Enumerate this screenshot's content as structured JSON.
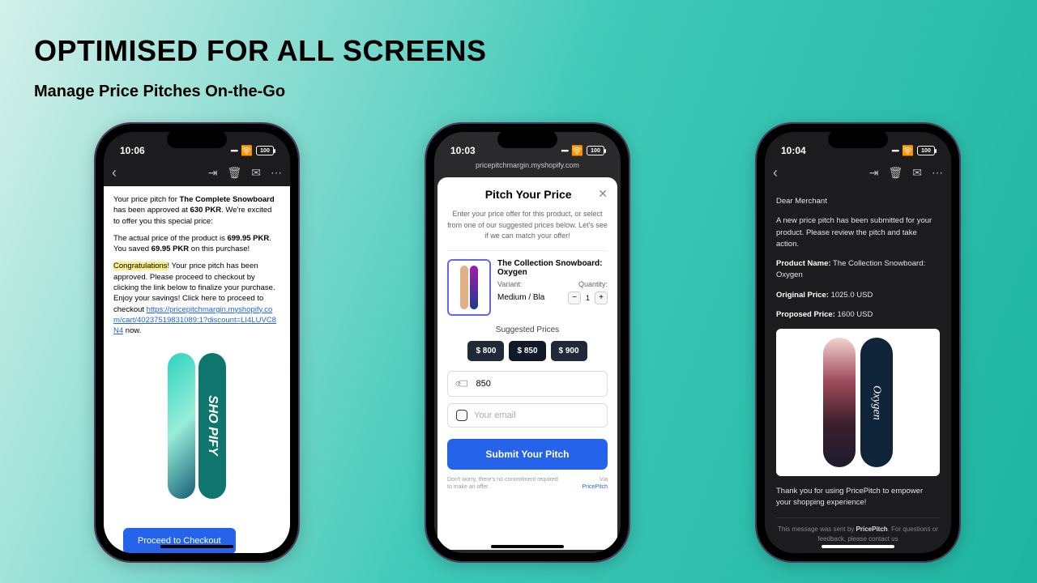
{
  "header": {
    "title": "OPTIMISED FOR ALL SCREENS",
    "subtitle": "Manage Price Pitches On-the-Go"
  },
  "phone1": {
    "time": "10:06",
    "battery": "100",
    "email": {
      "line1a": "Your price pitch for ",
      "line1b": "The Complete Snowboard",
      "line1c": " has been approved at ",
      "line1d": "630 PKR",
      "line1e": ". We're excited to offer you this special price:",
      "line2a": "The actual price of the product is ",
      "line2b": "699.95 PKR",
      "line2c": ". You saved ",
      "line2d": "69.95 PKR",
      "line2e": " on this purchase!",
      "congrats": "Congratulations",
      "line3": "! Your price pitch has been approved. Please proceed to checkout by clicking the link below to finalize your purchase. Enjoy your savings! Click here to proceed to checkout ",
      "link": "https://pricepitchmargin.myshopify.com/cart/40237519831089:1?discount=LI4LUVC8N4",
      "now": " now.",
      "board_text": "SHO PIFY",
      "cta": "Proceed to Checkout"
    }
  },
  "phone2": {
    "time": "10:03",
    "battery": "100",
    "url": "pricepitchmargin.myshopify.com",
    "modal": {
      "title": "Pitch Your Price",
      "sub": "Enter your price offer for this product, or select from one of our suggested prices below. Let's see if we can match your offer!",
      "product": "The Collection Snowboard: Oxygen",
      "variant_label": "Variant:",
      "quantity_label": "Quantity:",
      "variant_value": "Medium / Bla",
      "quantity": "1",
      "suggested_label": "Suggested Prices",
      "chips": [
        "$ 800",
        "$ 850",
        "$ 900"
      ],
      "price_input": "850",
      "email_placeholder": "Your email",
      "submit": "Submit Your Pitch",
      "footer_note": "Don't worry, there's no commitment required to make an offer.",
      "via": "Via",
      "brand": "PricePitch"
    }
  },
  "phone3": {
    "time": "10:04",
    "battery": "100",
    "email": {
      "greeting": "Dear Merchant",
      "intro": "A new price pitch has been submitted for your product. Please review the pitch and take action.",
      "pn_label": "Product Name:",
      "pn_value": " The Collection Snowboard: Oxygen",
      "op_label": "Original Price:",
      "op_value": " 1025.0 USD",
      "pp_label": "Proposed Price:",
      "pp_value": " 1600 USD",
      "board_text": "Oxygen",
      "thanks": "Thank you for using PricePitch to empower your shopping experience!",
      "footer_a": "This message was sent by ",
      "footer_b": "PricePitch",
      "footer_c": ". For questions or feedback, please contact us"
    }
  }
}
